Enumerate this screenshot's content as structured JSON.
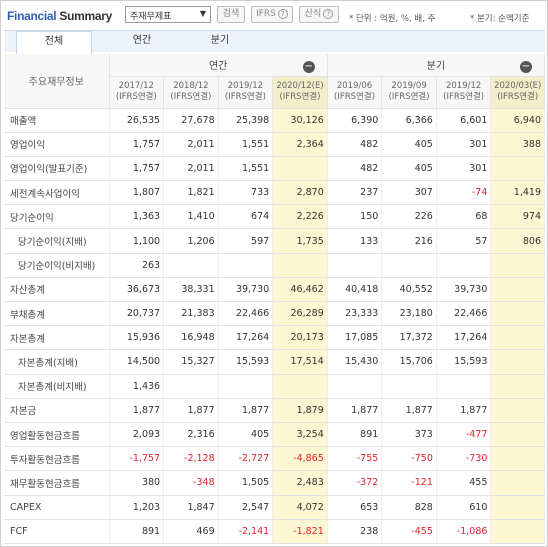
{
  "header": {
    "title_part1": "Financial",
    "title_part2": " Summary",
    "select_value": "주재무제표",
    "search_label": "검색",
    "ifrs_label": "IFRS",
    "formula_label": "산식",
    "unit_note": "* 단위 : 억원, %, 배, 주",
    "period_note": "* 분기: 순액기준"
  },
  "tabs": [
    {
      "label": "전체",
      "active": true
    },
    {
      "label": "연간",
      "active": false
    },
    {
      "label": "분기",
      "active": false
    }
  ],
  "table": {
    "corner_label": "주요재무정보",
    "group_annual": "연간",
    "group_quarter": "분기",
    "columns": [
      {
        "period": "2017/12",
        "basis": "(IFRS연결)"
      },
      {
        "period": "2018/12",
        "basis": "(IFRS연결)"
      },
      {
        "period": "2019/12",
        "basis": "(IFRS연결)"
      },
      {
        "period": "2020/12(E)",
        "basis": "(IFRS연결)"
      },
      {
        "period": "2019/06",
        "basis": "(IFRS연결)"
      },
      {
        "period": "2019/09",
        "basis": "(IFRS연결)"
      },
      {
        "period": "2019/12",
        "basis": "(IFRS연결)"
      },
      {
        "period": "2020/03(E)",
        "basis": "(IFRS연결)"
      }
    ],
    "rows": [
      {
        "label": "매출액",
        "indent": false,
        "values": [
          "26,535",
          "27,678",
          "25,398",
          "30,126",
          "6,390",
          "6,366",
          "6,601",
          "6,940"
        ]
      },
      {
        "label": "영업이익",
        "indent": false,
        "values": [
          "1,757",
          "2,011",
          "1,551",
          "2,364",
          "482",
          "405",
          "301",
          "388"
        ]
      },
      {
        "label": "영업이익(발표기준)",
        "indent": false,
        "values": [
          "1,757",
          "2,011",
          "1,551",
          "",
          "482",
          "405",
          "301",
          ""
        ]
      },
      {
        "label": "세전계속사업이익",
        "indent": false,
        "values": [
          "1,807",
          "1,821",
          "733",
          "2,870",
          "237",
          "307",
          "-74",
          "1,419"
        ]
      },
      {
        "label": "당기순이익",
        "indent": false,
        "values": [
          "1,363",
          "1,410",
          "674",
          "2,226",
          "150",
          "226",
          "68",
          "974"
        ]
      },
      {
        "label": "당기순이익(지배)",
        "indent": true,
        "values": [
          "1,100",
          "1,206",
          "597",
          "1,735",
          "133",
          "216",
          "57",
          "806"
        ]
      },
      {
        "label": "당기순이익(비지배)",
        "indent": true,
        "values": [
          "263",
          "",
          "",
          "",
          "",
          "",
          "",
          ""
        ]
      },
      {
        "label": "자산총계",
        "indent": false,
        "values": [
          "36,673",
          "38,331",
          "39,730",
          "46,462",
          "40,418",
          "40,552",
          "39,730",
          ""
        ]
      },
      {
        "label": "부채총계",
        "indent": false,
        "values": [
          "20,737",
          "21,383",
          "22,466",
          "26,289",
          "23,333",
          "23,180",
          "22,466",
          ""
        ]
      },
      {
        "label": "자본총계",
        "indent": false,
        "values": [
          "15,936",
          "16,948",
          "17,264",
          "20,173",
          "17,085",
          "17,372",
          "17,264",
          ""
        ]
      },
      {
        "label": "자본총계(지배)",
        "indent": true,
        "values": [
          "14,500",
          "15,327",
          "15,593",
          "17,514",
          "15,430",
          "15,706",
          "15,593",
          ""
        ]
      },
      {
        "label": "자본총계(비지배)",
        "indent": true,
        "values": [
          "1,436",
          "",
          "",
          "",
          "",
          "",
          "",
          ""
        ]
      },
      {
        "label": "자본금",
        "indent": false,
        "values": [
          "1,877",
          "1,877",
          "1,877",
          "1,879",
          "1,877",
          "1,877",
          "1,877",
          ""
        ]
      },
      {
        "label": "영업활동현금흐름",
        "indent": false,
        "values": [
          "2,093",
          "2,316",
          "405",
          "3,254",
          "891",
          "373",
          "-477",
          ""
        ]
      },
      {
        "label": "투자활동현금흐름",
        "indent": false,
        "values": [
          "-1,757",
          "-2,128",
          "-2,727",
          "-4,865",
          "-755",
          "-750",
          "-730",
          ""
        ]
      },
      {
        "label": "재무활동현금흐름",
        "indent": false,
        "values": [
          "380",
          "-348",
          "1,505",
          "2,483",
          "-372",
          "-121",
          "455",
          ""
        ]
      },
      {
        "label": "CAPEX",
        "indent": false,
        "values": [
          "1,203",
          "1,847",
          "2,547",
          "4,072",
          "653",
          "828",
          "610",
          ""
        ]
      },
      {
        "label": "FCF",
        "indent": false,
        "values": [
          "891",
          "469",
          "-2,141",
          "-1,821",
          "238",
          "-455",
          "-1,086",
          ""
        ]
      }
    ]
  },
  "colors": {
    "accent": "#2d5fb3",
    "negative": "#e0242c",
    "estimate_bg": "#fdf6d2"
  }
}
